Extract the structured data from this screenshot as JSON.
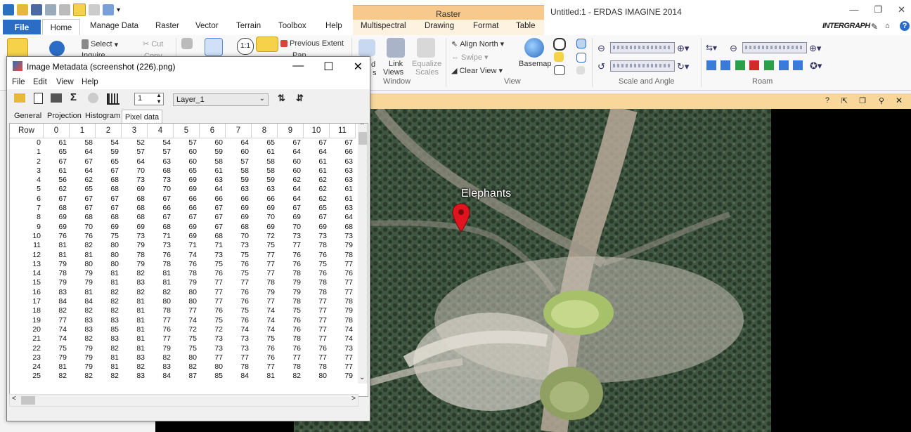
{
  "app": {
    "title": "Untitled:1 - ERDAS IMAGINE 2014",
    "context_tab_group": "Raster",
    "brand": "INTERGRAPH"
  },
  "ribbon_tabs": [
    "File",
    "Home",
    "Manage Data",
    "Raster",
    "Vector",
    "Terrain",
    "Toolbox",
    "Help"
  ],
  "context_tabs": [
    "Multispectral",
    "Drawing",
    "Format",
    "Table"
  ],
  "ribbon": {
    "select": "Select",
    "inquire": "Inquire",
    "cut": "Cut",
    "copy": "Copy",
    "previous_extent": "Previous Extent",
    "pan": "Pan",
    "link_views_1": "Link",
    "link_views_2": "Views",
    "equalize_1": "Equalize",
    "equalize_2": "Scales",
    "align_north": "Align North",
    "swipe": "Swipe",
    "clear_view": "Clear View",
    "basemap": "Basemap",
    "group_window": "Window",
    "group_view": "View",
    "group_scale": "Scale and Angle",
    "group_roam": "Roam",
    "partial_left": "d",
    "partial_left2": "s"
  },
  "dialog": {
    "title": "Image Metadata (screenshot (226).png)",
    "menu": [
      "File",
      "Edit",
      "View",
      "Help"
    ],
    "spin_value": "1",
    "layer": "Layer_1",
    "tabs": [
      "General",
      "Projection",
      "Histogram",
      "Pixel data"
    ],
    "active_tab": "Pixel data",
    "columns": [
      "Row",
      "0",
      "1",
      "2",
      "3",
      "4",
      "5",
      "6",
      "7",
      "8",
      "9",
      "10",
      "11"
    ],
    "rows": [
      [
        "0",
        "61",
        "58",
        "54",
        "52",
        "54",
        "57",
        "60",
        "64",
        "65",
        "67",
        "67",
        "67"
      ],
      [
        "1",
        "65",
        "64",
        "59",
        "57",
        "57",
        "60",
        "59",
        "60",
        "61",
        "64",
        "64",
        "66"
      ],
      [
        "2",
        "67",
        "67",
        "65",
        "64",
        "63",
        "60",
        "58",
        "57",
        "58",
        "60",
        "61",
        "63"
      ],
      [
        "3",
        "61",
        "64",
        "67",
        "70",
        "68",
        "65",
        "61",
        "58",
        "58",
        "60",
        "61",
        "63"
      ],
      [
        "4",
        "56",
        "62",
        "68",
        "73",
        "73",
        "69",
        "63",
        "59",
        "59",
        "62",
        "62",
        "63"
      ],
      [
        "5",
        "62",
        "65",
        "68",
        "69",
        "70",
        "69",
        "64",
        "63",
        "63",
        "64",
        "62",
        "61"
      ],
      [
        "6",
        "67",
        "67",
        "67",
        "68",
        "67",
        "66",
        "66",
        "66",
        "66",
        "64",
        "62",
        "61"
      ],
      [
        "7",
        "68",
        "67",
        "67",
        "68",
        "66",
        "66",
        "67",
        "69",
        "69",
        "67",
        "65",
        "63"
      ],
      [
        "8",
        "69",
        "68",
        "68",
        "68",
        "67",
        "67",
        "67",
        "69",
        "70",
        "69",
        "67",
        "64"
      ],
      [
        "9",
        "69",
        "70",
        "69",
        "69",
        "68",
        "69",
        "67",
        "68",
        "69",
        "70",
        "69",
        "68"
      ],
      [
        "10",
        "76",
        "76",
        "75",
        "73",
        "71",
        "69",
        "68",
        "70",
        "72",
        "73",
        "73",
        "73"
      ],
      [
        "11",
        "81",
        "82",
        "80",
        "79",
        "73",
        "71",
        "71",
        "73",
        "75",
        "77",
        "78",
        "79"
      ],
      [
        "12",
        "81",
        "81",
        "80",
        "78",
        "76",
        "74",
        "73",
        "75",
        "77",
        "76",
        "76",
        "78"
      ],
      [
        "13",
        "79",
        "80",
        "80",
        "79",
        "78",
        "76",
        "75",
        "76",
        "77",
        "76",
        "75",
        "77"
      ],
      [
        "14",
        "78",
        "79",
        "81",
        "82",
        "81",
        "78",
        "76",
        "75",
        "77",
        "78",
        "76",
        "76"
      ],
      [
        "15",
        "79",
        "79",
        "81",
        "83",
        "81",
        "79",
        "77",
        "77",
        "78",
        "79",
        "78",
        "77"
      ],
      [
        "16",
        "83",
        "81",
        "82",
        "82",
        "82",
        "80",
        "77",
        "76",
        "79",
        "79",
        "78",
        "77"
      ],
      [
        "17",
        "84",
        "84",
        "82",
        "81",
        "80",
        "80",
        "77",
        "76",
        "77",
        "78",
        "77",
        "78"
      ],
      [
        "18",
        "82",
        "82",
        "82",
        "81",
        "78",
        "77",
        "76",
        "75",
        "74",
        "75",
        "77",
        "79"
      ],
      [
        "19",
        "77",
        "83",
        "83",
        "81",
        "77",
        "74",
        "75",
        "76",
        "74",
        "76",
        "77",
        "78"
      ],
      [
        "20",
        "74",
        "83",
        "85",
        "81",
        "76",
        "72",
        "72",
        "74",
        "74",
        "76",
        "77",
        "74"
      ],
      [
        "21",
        "74",
        "82",
        "83",
        "81",
        "77",
        "75",
        "73",
        "73",
        "75",
        "78",
        "77",
        "74"
      ],
      [
        "22",
        "75",
        "79",
        "82",
        "81",
        "79",
        "75",
        "73",
        "73",
        "76",
        "76",
        "76",
        "73"
      ],
      [
        "23",
        "79",
        "79",
        "81",
        "83",
        "82",
        "80",
        "77",
        "77",
        "76",
        "77",
        "77",
        "77"
      ],
      [
        "24",
        "81",
        "79",
        "81",
        "82",
        "83",
        "82",
        "80",
        "78",
        "77",
        "78",
        "78",
        "77"
      ],
      [
        "25",
        "82",
        "82",
        "82",
        "83",
        "84",
        "87",
        "85",
        "84",
        "81",
        "82",
        "80",
        "79"
      ]
    ]
  },
  "map": {
    "placemark_label": "Elephants"
  },
  "colors": {
    "file_tab": "#2b6cc4",
    "context_tab": "#f7c98c",
    "viewer_bar": "#f9d79a",
    "pin": "#e0141e"
  }
}
